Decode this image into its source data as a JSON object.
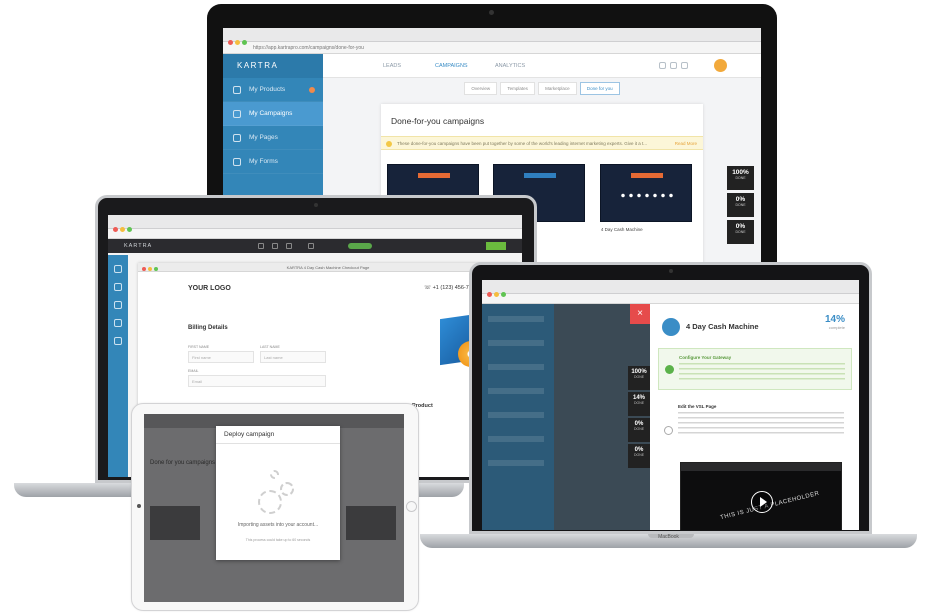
{
  "imac": {
    "browser_url": "https://app.kartrapro.com/campaigns/done-for-you",
    "logo": "KARTRA",
    "sidebar": [
      {
        "label": "My Products",
        "icon": "tag-icon",
        "active": false,
        "badge": true
      },
      {
        "label": "My Campaigns",
        "icon": "person-icon",
        "active": true,
        "badge": false
      },
      {
        "label": "My Pages",
        "icon": "page-icon",
        "active": false,
        "badge": false
      },
      {
        "label": "My Forms",
        "icon": "checkbox-icon",
        "active": false,
        "badge": false
      }
    ],
    "topnav": [
      {
        "label": "LEADS",
        "active": false
      },
      {
        "label": "CAMPAIGNS",
        "active": true
      },
      {
        "label": "ANALYTICS",
        "active": false
      }
    ],
    "subtabs": [
      {
        "label": "Overview",
        "active": false
      },
      {
        "label": "Templates",
        "active": false
      },
      {
        "label": "Marketplace",
        "active": false
      },
      {
        "label": "Done for you",
        "active": true
      }
    ],
    "heading": "Done-for-you campaigns",
    "notice": "These done-for-you campaigns have been put together by some of the world's leading internet marketing experts. Give it a t...",
    "notice_link": "Read More",
    "thumb_captions": [
      "",
      "4 Day Cash Machine"
    ],
    "stats": [
      {
        "value": "100%",
        "label": "DONE"
      },
      {
        "value": "0%",
        "label": "DONE"
      },
      {
        "value": "0%",
        "label": "DONE"
      }
    ]
  },
  "laptop_left": {
    "logo": "KARTRA",
    "window_title": "KARTRA 4 Day Cash Machine Checkout Page",
    "your_logo": "YOUR LOGO",
    "phone": "+1 (123) 456-7890",
    "billing_heading": "Billing Details",
    "field_labels": [
      "FIRST NAME",
      "LAST NAME",
      "EMAIL"
    ],
    "field_placeholders": [
      "First name",
      "Last name",
      "Email"
    ],
    "product_heading": "Product"
  },
  "laptop_right": {
    "title": "4 Day Cash Machine",
    "percent": "14%",
    "percent_label": "complete",
    "close": "×",
    "step1_title": "Configure Your Gateway",
    "step2_title": "Edit the VSL Page",
    "video_text": "THIS IS JUST A PLACEHOLDER",
    "base_label": "MacBook",
    "stats": [
      {
        "value": "100%",
        "label": "DONE"
      },
      {
        "value": "14%",
        "label": "DONE"
      },
      {
        "value": "0%",
        "label": "DONE"
      },
      {
        "value": "0%",
        "label": "DONE"
      }
    ]
  },
  "ipad": {
    "bg_title": "Done for you campaigns",
    "modal_title": "Deploy campaign",
    "modal_message": "Importing assets into your account...",
    "modal_sub": "This process could take up to 60 seconds"
  },
  "colors": {
    "kartra_blue": "#3386b8",
    "close_red": "#e64b4b",
    "success_green": "#5bb24a",
    "accent_orange": "#e56a34"
  }
}
